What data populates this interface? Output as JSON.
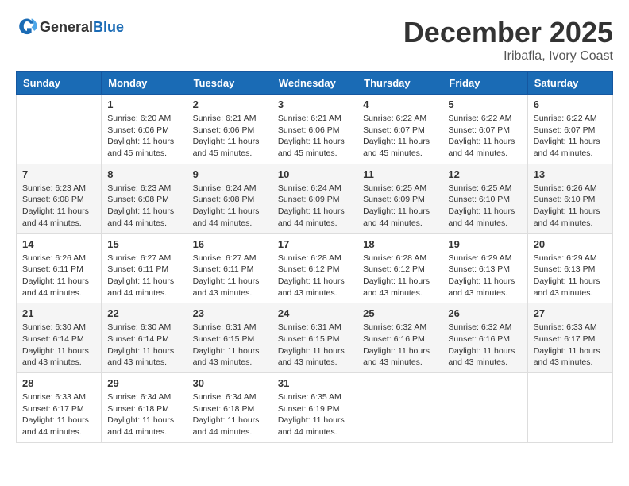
{
  "header": {
    "logo_general": "General",
    "logo_blue": "Blue",
    "month": "December 2025",
    "location": "Iribafla, Ivory Coast"
  },
  "weekdays": [
    "Sunday",
    "Monday",
    "Tuesday",
    "Wednesday",
    "Thursday",
    "Friday",
    "Saturday"
  ],
  "weeks": [
    [
      {
        "day": "",
        "info": ""
      },
      {
        "day": "1",
        "info": "Sunrise: 6:20 AM\nSunset: 6:06 PM\nDaylight: 11 hours\nand 45 minutes."
      },
      {
        "day": "2",
        "info": "Sunrise: 6:21 AM\nSunset: 6:06 PM\nDaylight: 11 hours\nand 45 minutes."
      },
      {
        "day": "3",
        "info": "Sunrise: 6:21 AM\nSunset: 6:06 PM\nDaylight: 11 hours\nand 45 minutes."
      },
      {
        "day": "4",
        "info": "Sunrise: 6:22 AM\nSunset: 6:07 PM\nDaylight: 11 hours\nand 45 minutes."
      },
      {
        "day": "5",
        "info": "Sunrise: 6:22 AM\nSunset: 6:07 PM\nDaylight: 11 hours\nand 44 minutes."
      },
      {
        "day": "6",
        "info": "Sunrise: 6:22 AM\nSunset: 6:07 PM\nDaylight: 11 hours\nand 44 minutes."
      }
    ],
    [
      {
        "day": "7",
        "info": "Sunrise: 6:23 AM\nSunset: 6:08 PM\nDaylight: 11 hours\nand 44 minutes."
      },
      {
        "day": "8",
        "info": "Sunrise: 6:23 AM\nSunset: 6:08 PM\nDaylight: 11 hours\nand 44 minutes."
      },
      {
        "day": "9",
        "info": "Sunrise: 6:24 AM\nSunset: 6:08 PM\nDaylight: 11 hours\nand 44 minutes."
      },
      {
        "day": "10",
        "info": "Sunrise: 6:24 AM\nSunset: 6:09 PM\nDaylight: 11 hours\nand 44 minutes."
      },
      {
        "day": "11",
        "info": "Sunrise: 6:25 AM\nSunset: 6:09 PM\nDaylight: 11 hours\nand 44 minutes."
      },
      {
        "day": "12",
        "info": "Sunrise: 6:25 AM\nSunset: 6:10 PM\nDaylight: 11 hours\nand 44 minutes."
      },
      {
        "day": "13",
        "info": "Sunrise: 6:26 AM\nSunset: 6:10 PM\nDaylight: 11 hours\nand 44 minutes."
      }
    ],
    [
      {
        "day": "14",
        "info": "Sunrise: 6:26 AM\nSunset: 6:11 PM\nDaylight: 11 hours\nand 44 minutes."
      },
      {
        "day": "15",
        "info": "Sunrise: 6:27 AM\nSunset: 6:11 PM\nDaylight: 11 hours\nand 44 minutes."
      },
      {
        "day": "16",
        "info": "Sunrise: 6:27 AM\nSunset: 6:11 PM\nDaylight: 11 hours\nand 43 minutes."
      },
      {
        "day": "17",
        "info": "Sunrise: 6:28 AM\nSunset: 6:12 PM\nDaylight: 11 hours\nand 43 minutes."
      },
      {
        "day": "18",
        "info": "Sunrise: 6:28 AM\nSunset: 6:12 PM\nDaylight: 11 hours\nand 43 minutes."
      },
      {
        "day": "19",
        "info": "Sunrise: 6:29 AM\nSunset: 6:13 PM\nDaylight: 11 hours\nand 43 minutes."
      },
      {
        "day": "20",
        "info": "Sunrise: 6:29 AM\nSunset: 6:13 PM\nDaylight: 11 hours\nand 43 minutes."
      }
    ],
    [
      {
        "day": "21",
        "info": "Sunrise: 6:30 AM\nSunset: 6:14 PM\nDaylight: 11 hours\nand 43 minutes."
      },
      {
        "day": "22",
        "info": "Sunrise: 6:30 AM\nSunset: 6:14 PM\nDaylight: 11 hours\nand 43 minutes."
      },
      {
        "day": "23",
        "info": "Sunrise: 6:31 AM\nSunset: 6:15 PM\nDaylight: 11 hours\nand 43 minutes."
      },
      {
        "day": "24",
        "info": "Sunrise: 6:31 AM\nSunset: 6:15 PM\nDaylight: 11 hours\nand 43 minutes."
      },
      {
        "day": "25",
        "info": "Sunrise: 6:32 AM\nSunset: 6:16 PM\nDaylight: 11 hours\nand 43 minutes."
      },
      {
        "day": "26",
        "info": "Sunrise: 6:32 AM\nSunset: 6:16 PM\nDaylight: 11 hours\nand 43 minutes."
      },
      {
        "day": "27",
        "info": "Sunrise: 6:33 AM\nSunset: 6:17 PM\nDaylight: 11 hours\nand 43 minutes."
      }
    ],
    [
      {
        "day": "28",
        "info": "Sunrise: 6:33 AM\nSunset: 6:17 PM\nDaylight: 11 hours\nand 44 minutes."
      },
      {
        "day": "29",
        "info": "Sunrise: 6:34 AM\nSunset: 6:18 PM\nDaylight: 11 hours\nand 44 minutes."
      },
      {
        "day": "30",
        "info": "Sunrise: 6:34 AM\nSunset: 6:18 PM\nDaylight: 11 hours\nand 44 minutes."
      },
      {
        "day": "31",
        "info": "Sunrise: 6:35 AM\nSunset: 6:19 PM\nDaylight: 11 hours\nand 44 minutes."
      },
      {
        "day": "",
        "info": ""
      },
      {
        "day": "",
        "info": ""
      },
      {
        "day": "",
        "info": ""
      }
    ]
  ]
}
